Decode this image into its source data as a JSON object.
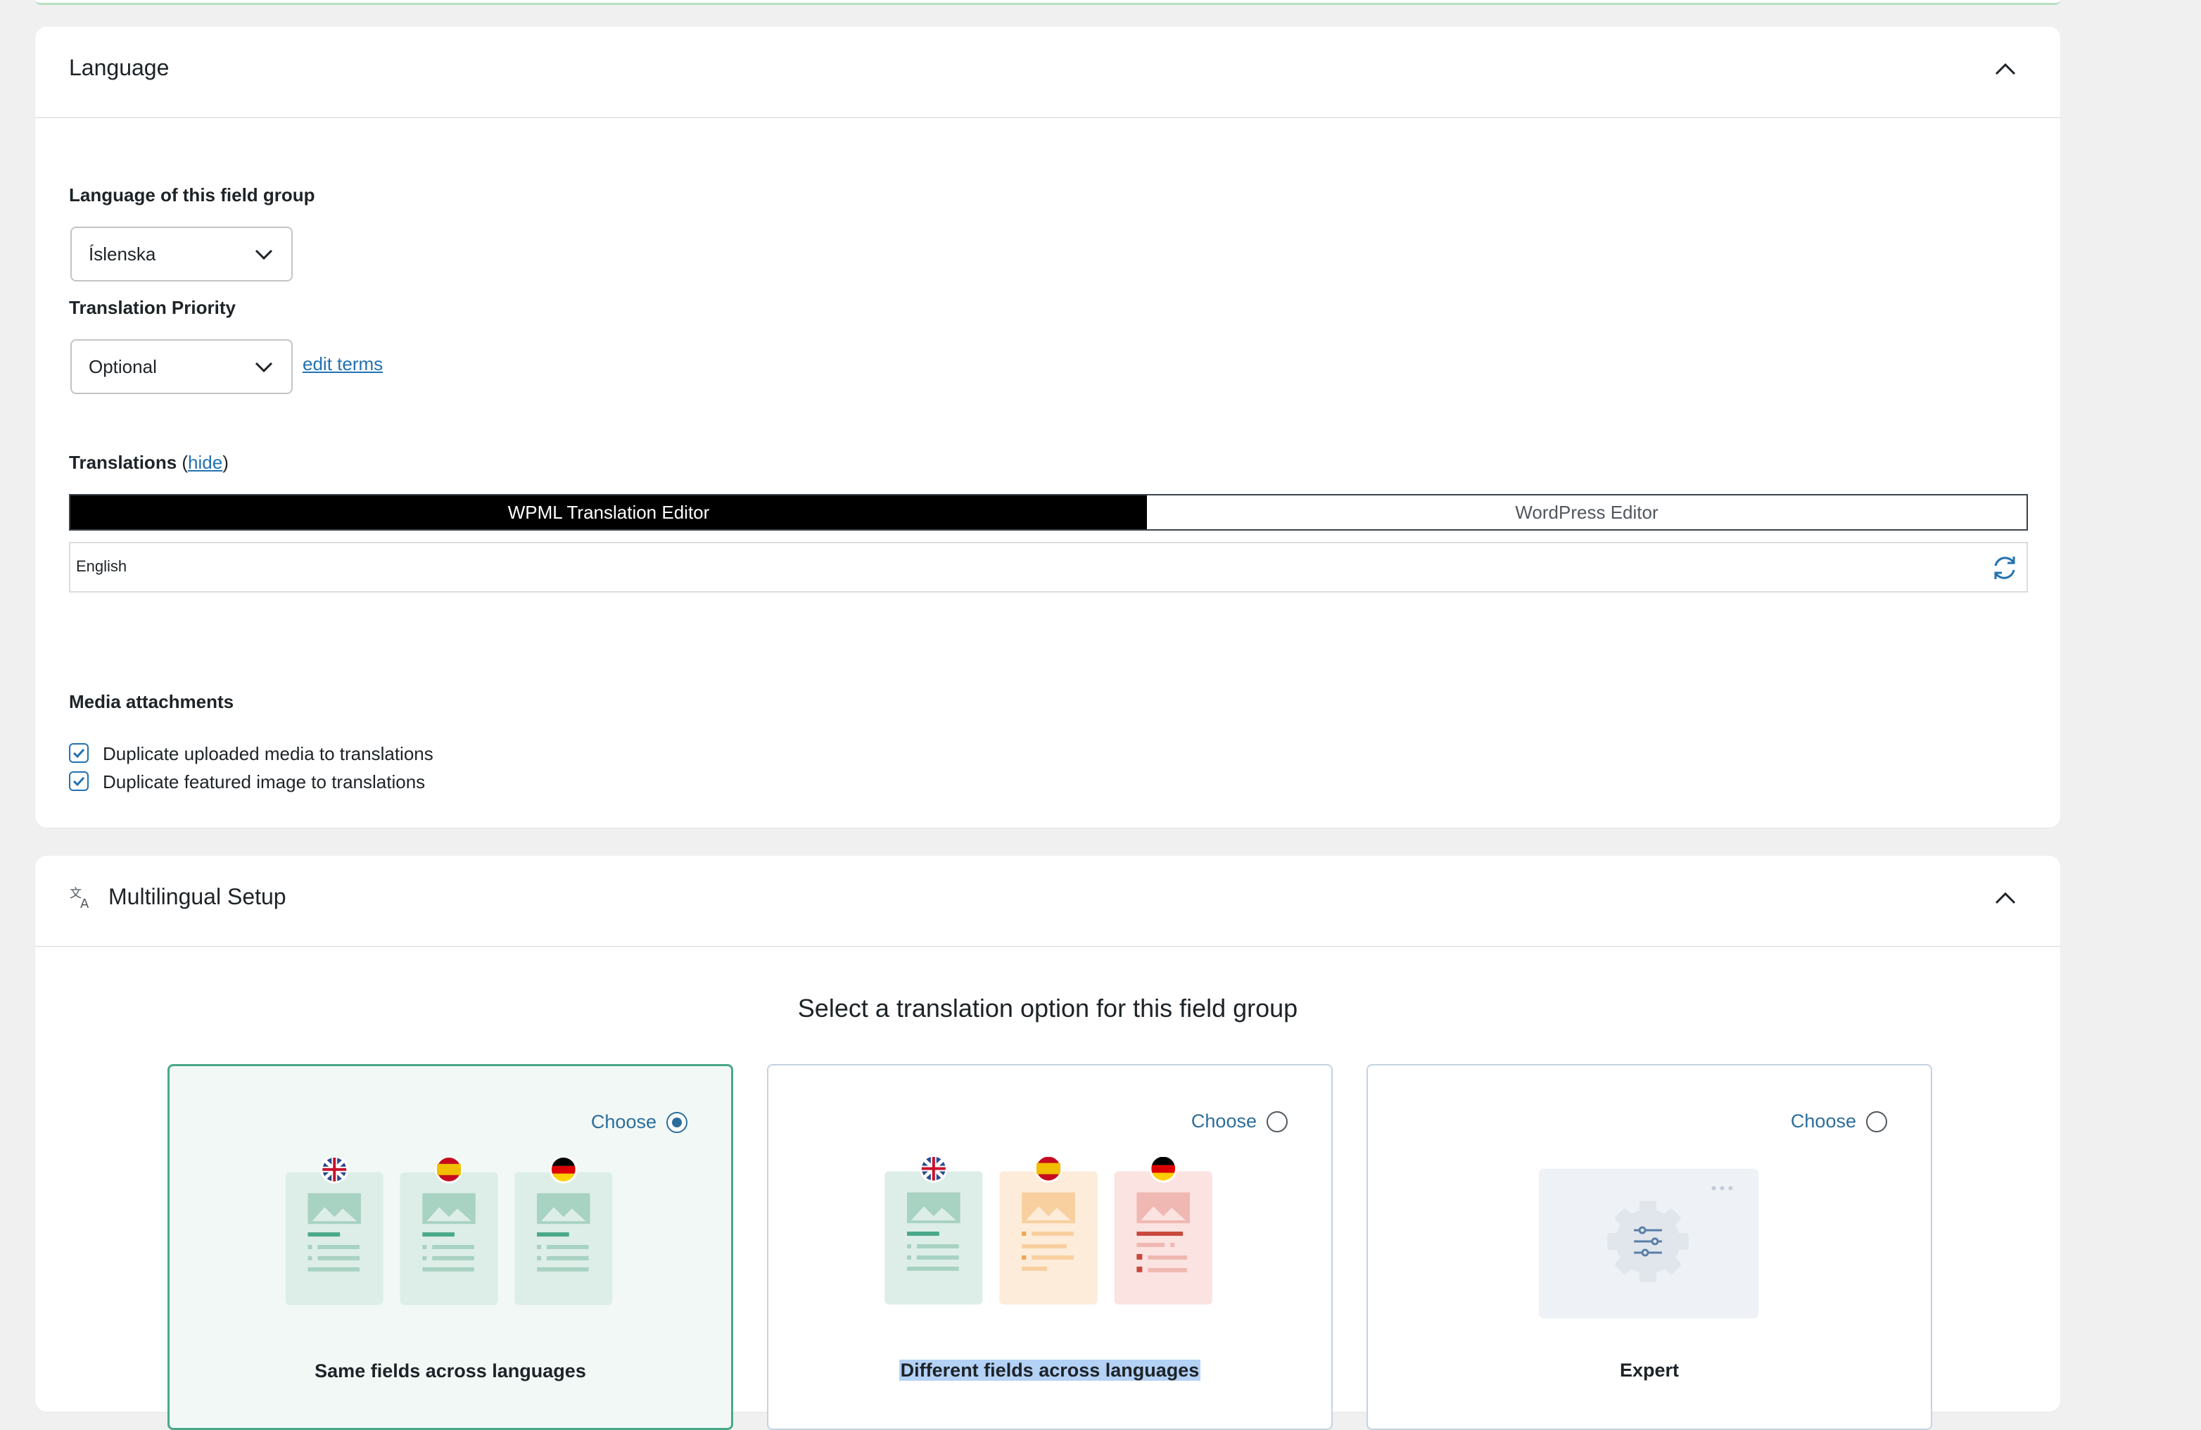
{
  "language_panel": {
    "title": "Language",
    "field_group_language_label": "Language of this field group",
    "field_group_language_value": "Íslenska",
    "translation_priority_label": "Translation Priority",
    "translation_priority_value": "Optional",
    "edit_terms_link": "edit terms",
    "translations_label": "Translations",
    "translations_hide_link": "hide",
    "editor_tabs": [
      {
        "label": "WPML Translation Editor",
        "active": true
      },
      {
        "label": "WordPress Editor",
        "active": false
      }
    ],
    "translation_language_row": "English",
    "media_attachments_label": "Media attachments",
    "media_options": [
      {
        "label": "Duplicate uploaded media to translations",
        "checked": true
      },
      {
        "label": "Duplicate featured image to translations",
        "checked": true
      }
    ]
  },
  "multilingual_panel": {
    "title": "Multilingual Setup",
    "heading": "Select a translation option for this field group",
    "options": [
      {
        "title": "Same fields across languages",
        "choose_label": "Choose",
        "selected": true
      },
      {
        "title": "Different fields across languages",
        "choose_label": "Choose",
        "selected": false
      },
      {
        "title": "Expert",
        "choose_label": "Choose",
        "selected": false
      }
    ]
  },
  "colors": {
    "link": "#2271b1",
    "selected_card_border": "#4aa88a",
    "active_tab_bg": "#000000"
  },
  "icons": {
    "collapse": "chevron-up-icon",
    "refresh": "refresh-icon",
    "translate": "translate-icon",
    "checkbox": "checkmark-icon",
    "flags": [
      "uk-flag-icon",
      "spain-flag-icon",
      "germany-flag-icon"
    ],
    "expert": "settings-gear-icon"
  }
}
